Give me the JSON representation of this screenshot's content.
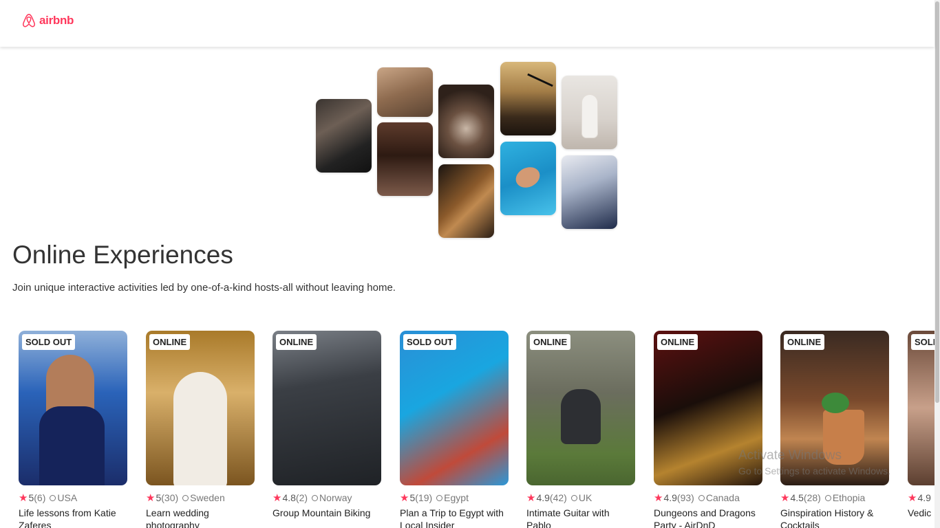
{
  "header": {
    "logo_text": "airbnb",
    "logo_color": "#FF385C"
  },
  "hero": {
    "title": "Online Experiences",
    "subtitle": "Join unique interactive activities led by one-of-a-kind hosts-all without leaving home."
  },
  "accent_color": "#FE385C",
  "cards": [
    {
      "badge": "SOLD OUT",
      "rating": "5",
      "reviews": "(6)",
      "location": "USA",
      "title": "Life lessons from Katie Zaferes"
    },
    {
      "badge": "ONLINE",
      "rating": "5",
      "reviews": "(30)",
      "location": "Sweden",
      "title": "Learn wedding photography"
    },
    {
      "badge": "ONLINE",
      "rating": "4.8",
      "reviews": "(2)",
      "location": "Norway",
      "title": "Group Mountain Biking"
    },
    {
      "badge": "SOLD OUT",
      "rating": "5",
      "reviews": "(19)",
      "location": "Egypt",
      "title": "Plan a Trip to Egypt with Local Insider"
    },
    {
      "badge": "ONLINE",
      "rating": "4.9",
      "reviews": "(42)",
      "location": "UK",
      "title": "Intimate Guitar with Pablo"
    },
    {
      "badge": "ONLINE",
      "rating": "4.9",
      "reviews": "(93)",
      "location": "Canada",
      "title": "Dungeons and Dragons Party - AirDnD"
    },
    {
      "badge": "ONLINE",
      "rating": "4.5",
      "reviews": "(28)",
      "location": "Ethopia",
      "title": "Ginspiration History & Cocktails"
    },
    {
      "badge": "SOLD OUT",
      "rating": "4.9",
      "reviews": "",
      "location": "",
      "title": "Vedic Reading"
    }
  ],
  "watermark": {
    "line1": "Activate Windows",
    "line2": "Go to Settings to activate Windows."
  }
}
